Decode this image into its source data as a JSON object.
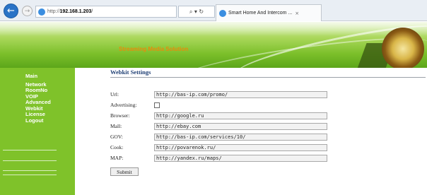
{
  "browser": {
    "address_protocol": "http://",
    "address_host": "192.168.1.203",
    "address_rest": "/",
    "tools_label": "⌕ ▾ ↻",
    "tab_title": "Smart Home And Intercom ...",
    "tab_close": "×",
    "back_glyph": "←",
    "forward_glyph": "→"
  },
  "banner": {
    "title": "Streaming Media Solution"
  },
  "sidebar": {
    "items": [
      {
        "label": "Main"
      },
      {
        "label": "Network"
      },
      {
        "label": "RoomNo"
      },
      {
        "label": "VOIP"
      },
      {
        "label": "Advanced"
      },
      {
        "label": "Webkit"
      },
      {
        "label": "License"
      },
      {
        "label": "Logout"
      }
    ]
  },
  "form": {
    "title": "Webkit Settings",
    "advertising_label": "Advertising:",
    "url_label": "Url:",
    "url_value": "http://bas-ip.com/promo/",
    "browser_label": "Browser:",
    "browser_value": "http://google.ru",
    "mall_label": "Mall:",
    "mall_value": "http://ebay.com",
    "gov_label": "GOV:",
    "gov_value": "http://bas-ip.com/services/10/",
    "cook_label": "Cook:",
    "cook_value": "http://povarenok.ru/",
    "map_label": "MAP:",
    "map_value": "http://yandex.ru/maps/",
    "submit_label": "Submit"
  },
  "colors": {
    "sidebar": "#7fc22a",
    "banner_title": "#e88a0c",
    "heading": "#1f3f74"
  }
}
